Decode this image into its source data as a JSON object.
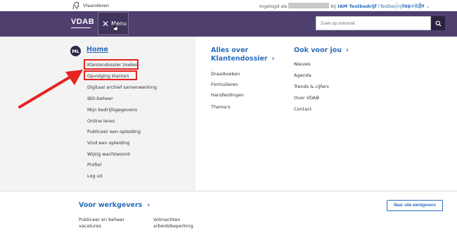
{
  "topbar": {
    "brand": "Vlaanderen",
    "login_prefix": "Ingelogd als",
    "login_middle": "bij",
    "org_name": "IAM Testbedrijf",
    "org_detail": "(Testbedrijflaan (23)",
    "logout": "Log uit"
  },
  "header": {
    "logo": "VDAB",
    "menu_label": "Menu",
    "search_placeholder": "Zoek op extranet"
  },
  "left": {
    "avatar": "ML",
    "home": "Home",
    "items": [
      "Klantendossier zoeken",
      "Opvolging klanten",
      "Digitaal archief samenwerking",
      "IBO-beheer",
      "Mijn bedrijfsgegevens",
      "Online leren",
      "Publiceer een opleiding",
      "Vind een opleiding",
      "Wijzig wachtwoord",
      "Profiel",
      "Log uit"
    ]
  },
  "middle": {
    "title_line1": "Alles over",
    "title_line2": "Klantendossier",
    "items": [
      "Draaiboeken",
      "Formulieren",
      "Handleidingen",
      "Thema's"
    ]
  },
  "right": {
    "title": "Ook voor jou",
    "items": [
      "Nieuws",
      "Agenda",
      "Trends & cijfers",
      "Over VDAB",
      "Contact"
    ]
  },
  "footer": {
    "title": "Voor werkgevers",
    "site_button": "Naar site werkgevers",
    "col1_line1": "Publiceer en beheer",
    "col1_line2": "vacatures",
    "col2_line1": "Volmachten",
    "col2_line2": "arbeidsbeperking"
  },
  "colors": {
    "header_bg": "#4e3f6e",
    "link_blue": "#2a6ebb",
    "highlight_red": "#e52322"
  }
}
